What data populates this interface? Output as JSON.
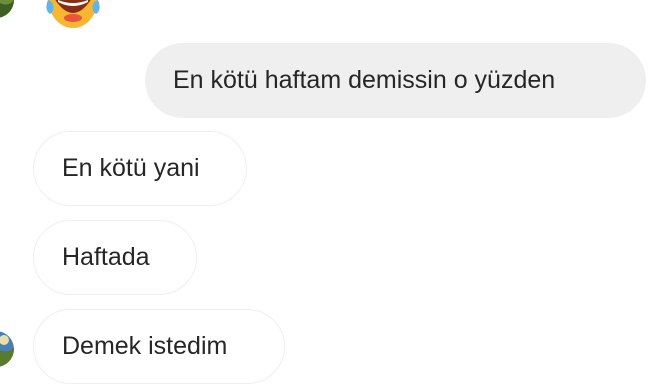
{
  "thread": {
    "messages": [
      {
        "id": "m1",
        "direction": "received",
        "type": "emoji",
        "icon": "tears-of-joy-emoji"
      },
      {
        "id": "m2",
        "direction": "sent",
        "text": "En kötü haftam demissin o yüzden"
      },
      {
        "id": "m3",
        "direction": "received",
        "text": "En kötü yani"
      },
      {
        "id": "m4",
        "direction": "received",
        "text": "Haftada"
      },
      {
        "id": "m5",
        "direction": "received",
        "text": "Demek istedim"
      }
    ]
  },
  "colors": {
    "sent_bubble": "#efefef",
    "received_border": "#efefef",
    "text": "#262626",
    "emoji_face": "#f7b731"
  }
}
